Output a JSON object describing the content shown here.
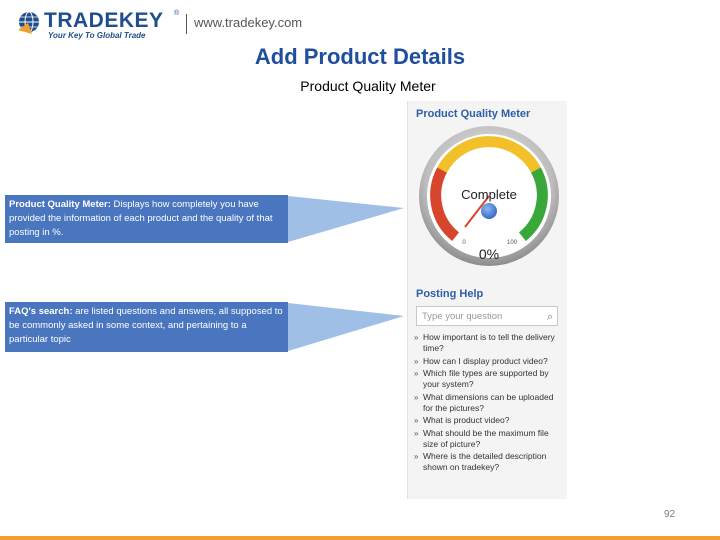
{
  "header": {
    "logo_name": "TRADEKEY",
    "logo_reg": "®",
    "tagline": "Your Key To Global Trade",
    "url": "www.tradekey.com"
  },
  "title": "Add Product Details",
  "subtitle": "Product Quality Meter",
  "callouts": [
    {
      "term": "Product Quality Meter:",
      "text": " Displays how completely you have provided the information of each product and the quality of that posting in %."
    },
    {
      "term": "FAQ's search:",
      "text": " are listed questions and answers, all supposed to be commonly asked in some context, and pertaining to a particular topic"
    }
  ],
  "panel": {
    "meter_title": "Product Quality Meter",
    "gauge": {
      "label": "Complete",
      "percent_text": "0%",
      "min": "0",
      "max": "100",
      "value": 0
    },
    "help_title": "Posting Help",
    "search_placeholder": "Type your question",
    "faq": [
      "How important is to tell the delivery time?",
      "How can I display product video?",
      "Which file types are supported by your system?",
      "What dimensions can be uploaded for the pictures?",
      "What is product video?",
      "What should be the maximum file size of picture?",
      "Where is the detailed description shown on tradekey?"
    ]
  },
  "page_number": "92",
  "colors": {
    "brand_blue": "#1f4e8c",
    "callout_bg": "#4a76c0",
    "heading_blue": "#2d5ea8",
    "accent_orange": "#f0a030"
  },
  "icons": {
    "logo": "globe-key-icon",
    "search": "search-icon"
  }
}
